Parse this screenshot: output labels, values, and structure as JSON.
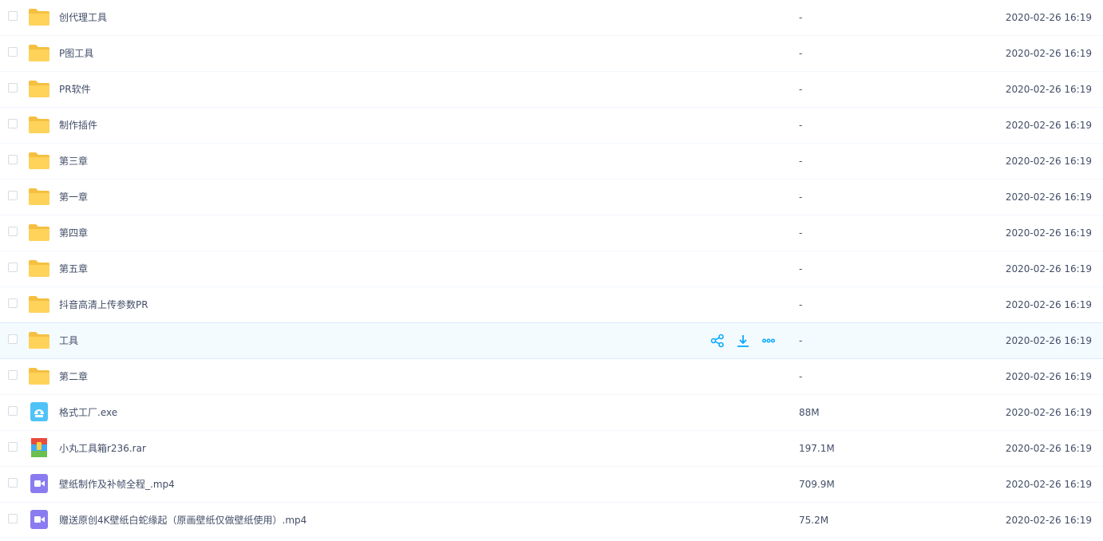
{
  "files": [
    {
      "name": "创代理工具",
      "size": "-",
      "date": "2020-02-26 16:19",
      "type": "folder"
    },
    {
      "name": "P图工具",
      "size": "-",
      "date": "2020-02-26 16:19",
      "type": "folder"
    },
    {
      "name": "PR软件",
      "size": "-",
      "date": "2020-02-26 16:19",
      "type": "folder"
    },
    {
      "name": "制作插件",
      "size": "-",
      "date": "2020-02-26 16:19",
      "type": "folder"
    },
    {
      "name": "第三章",
      "size": "-",
      "date": "2020-02-26 16:19",
      "type": "folder"
    },
    {
      "name": "第一章",
      "size": "-",
      "date": "2020-02-26 16:19",
      "type": "folder"
    },
    {
      "name": "第四章",
      "size": "-",
      "date": "2020-02-26 16:19",
      "type": "folder"
    },
    {
      "name": "第五章",
      "size": "-",
      "date": "2020-02-26 16:19",
      "type": "folder"
    },
    {
      "name": "抖音高清上传参数PR",
      "size": "-",
      "date": "2020-02-26 16:19",
      "type": "folder"
    },
    {
      "name": "工具",
      "size": "-",
      "date": "2020-02-26 16:19",
      "type": "folder"
    },
    {
      "name": "第二章",
      "size": "-",
      "date": "2020-02-26 16:19",
      "type": "folder"
    },
    {
      "name": "格式工厂.exe",
      "size": "88M",
      "date": "2020-02-26 16:19",
      "type": "exe"
    },
    {
      "name": "小丸工具箱r236.rar",
      "size": "197.1M",
      "date": "2020-02-26 16:19",
      "type": "rar"
    },
    {
      "name": "壁纸制作及补帧全程_.mp4",
      "size": "709.9M",
      "date": "2020-02-26 16:19",
      "type": "video"
    },
    {
      "name": "赠送原创4K壁纸白蛇缘起（原画壁纸仅做壁纸使用）.mp4",
      "size": "75.2M",
      "date": "2020-02-26 16:19",
      "type": "video"
    }
  ],
  "hover_row_index": 9,
  "colors": {
    "folder": "#ffd25a",
    "folder_dark": "#f5c040",
    "action": "#09aaff",
    "video": "#8a7cf0",
    "exe": "#4fc3f7"
  },
  "icons": {
    "folder": "folder-icon",
    "exe": "exe-file-icon",
    "rar": "archive-file-icon",
    "video": "video-file-icon",
    "share": "share-icon",
    "download": "download-icon",
    "more": "more-icon"
  }
}
